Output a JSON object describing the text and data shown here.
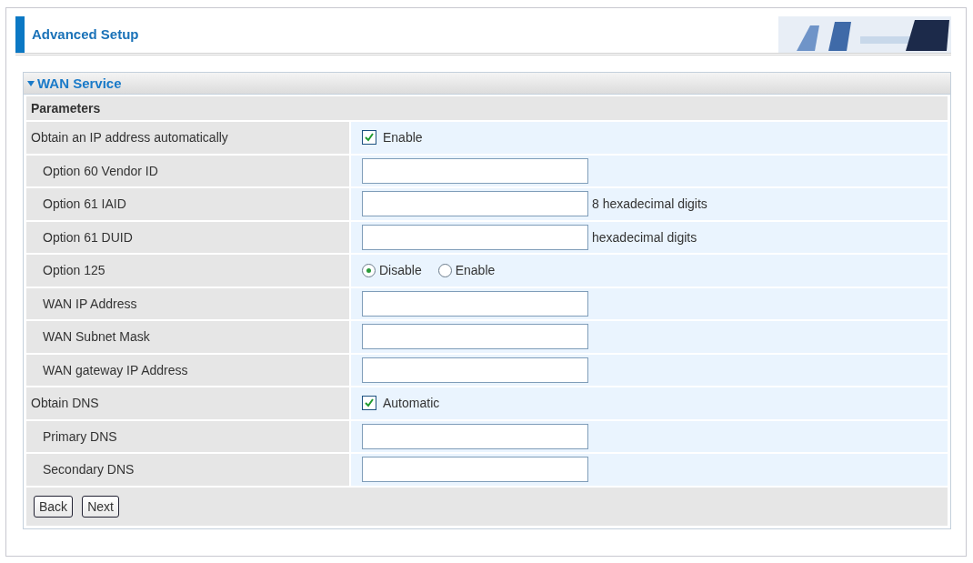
{
  "header": {
    "title": "Advanced Setup"
  },
  "section": {
    "title": "WAN Service",
    "expanded": true,
    "subtitle": "Parameters",
    "rows": [
      {
        "label": "Obtain an IP address automatically",
        "kind": "checkbox",
        "option": "Enable",
        "checked": true,
        "children": [
          {
            "label": "Option 60 Vendor ID",
            "kind": "input"
          },
          {
            "label": "Option 61 IAID",
            "kind": "input",
            "note": "8 hexadecimal digits"
          },
          {
            "label": "Option 61 DUID",
            "kind": "input",
            "note": "hexadecimal digits"
          },
          {
            "label": "Option 125",
            "kind": "radio",
            "options": [
              {
                "label": "Disable",
                "selected": true
              },
              {
                "label": "Enable",
                "selected": false
              }
            ]
          },
          {
            "label": "WAN IP Address",
            "kind": "input"
          },
          {
            "label": "WAN Subnet Mask",
            "kind": "input"
          },
          {
            "label": "WAN gateway IP Address",
            "kind": "input"
          }
        ]
      },
      {
        "label": "Obtain DNS",
        "kind": "checkbox",
        "option": "Automatic",
        "checked": true,
        "children": [
          {
            "label": "Primary DNS",
            "kind": "input"
          },
          {
            "label": "Secondary DNS",
            "kind": "input"
          }
        ]
      }
    ],
    "buttons": [
      "Back",
      "Next"
    ]
  }
}
